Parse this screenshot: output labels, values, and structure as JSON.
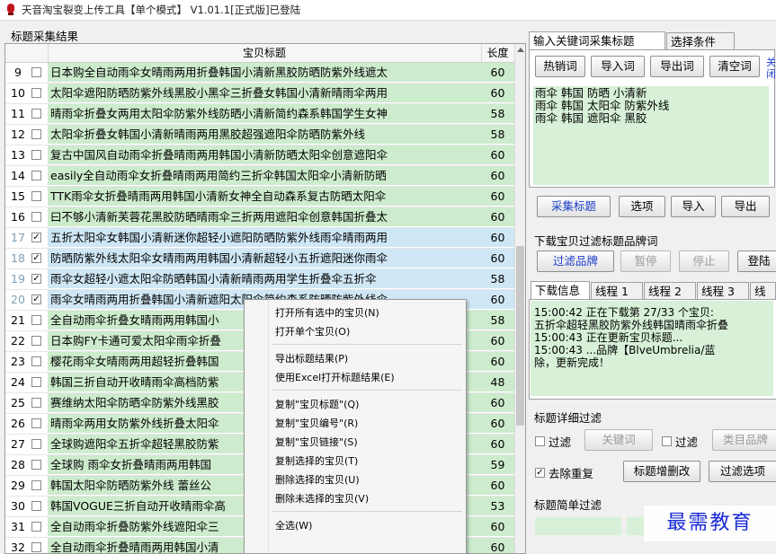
{
  "window": {
    "title": "天音淘宝裂变上传工具【单个模式】 V1.01.1[正式版]已登陆"
  },
  "left": {
    "section_label": "标题采集结果",
    "columns": {
      "title": "宝贝标题",
      "length": "长度"
    },
    "rows": [
      {
        "n": "9",
        "checked": false,
        "selected": false,
        "title": "日本购全自动雨伞女晴雨两用折叠韩国小清新黑胶防晒防紫外线遮太",
        "len": "60"
      },
      {
        "n": "10",
        "checked": false,
        "selected": false,
        "title": "太阳伞遮阳防晒防紫外线黑胶小黑伞三折叠女韩国小清新晴雨伞两用",
        "len": "60"
      },
      {
        "n": "11",
        "checked": false,
        "selected": false,
        "title": "晴雨伞折叠女两用太阳伞防紫外线防晒小清新简约森系韩国学生女神",
        "len": "58"
      },
      {
        "n": "12",
        "checked": false,
        "selected": false,
        "title": "太阳伞折叠女韩国小清新晴雨两用黑胶超强遮阳伞防晒防紫外线",
        "len": "58"
      },
      {
        "n": "13",
        "checked": false,
        "selected": false,
        "title": "复古中国风自动雨伞折叠晴雨两用韩国小清新防晒太阳伞创意遮阳伞",
        "len": "60"
      },
      {
        "n": "14",
        "checked": false,
        "selected": false,
        "title": "easily全自动雨伞女折叠晴雨两用简约三折伞韩国太阳伞小清新防晒",
        "len": "60"
      },
      {
        "n": "15",
        "checked": false,
        "selected": false,
        "title": "TTK雨伞女折叠晴雨两用韩国小清新女神全自动森系复古防晒太阳伞",
        "len": "60"
      },
      {
        "n": "16",
        "checked": false,
        "selected": false,
        "title": "曰不够小清新芙蓉花黑胶防晒晴雨伞三折两用遮阳伞创意韩国折叠太",
        "len": "60"
      },
      {
        "n": "17",
        "checked": true,
        "selected": true,
        "title": "五折太阳伞女韩国小清新迷你超轻小遮阳防晒防紫外线雨伞晴雨两用",
        "len": "60"
      },
      {
        "n": "18",
        "checked": true,
        "selected": true,
        "title": "防晒防紫外线太阳伞女晴雨两用韩国小清新超轻小五折遮阳迷你雨伞",
        "len": "60"
      },
      {
        "n": "19",
        "checked": true,
        "selected": true,
        "title": "雨伞女超轻小遮太阳伞防晒韩国小清新晴雨两用学生折叠伞五折伞",
        "len": "58"
      },
      {
        "n": "20",
        "checked": true,
        "selected": true,
        "title": "雨伞女晴雨两用折叠韩国小清新遮阳太阳伞简约森系防晒防紫外线伞",
        "len": "60"
      },
      {
        "n": "21",
        "checked": false,
        "selected": false,
        "title": "全自动雨伞折叠女晴雨两用韩国小",
        "len": "58"
      },
      {
        "n": "22",
        "checked": false,
        "selected": false,
        "title": "日本购FY卡通可爱太阳伞雨伞折叠",
        "len": "60"
      },
      {
        "n": "23",
        "checked": false,
        "selected": false,
        "title": "樱花雨伞女晴雨两用超轻折叠韩国",
        "len": "60"
      },
      {
        "n": "24",
        "checked": false,
        "selected": false,
        "title": "韩国三折自动开收晴雨伞高档防紫",
        "len": "48"
      },
      {
        "n": "25",
        "checked": false,
        "selected": false,
        "title": "赛维纳太阳伞防晒伞防紫外线黑胶",
        "len": "60"
      },
      {
        "n": "26",
        "checked": false,
        "selected": false,
        "title": "晴雨伞两用女防紫外线折叠太阳伞",
        "len": "60"
      },
      {
        "n": "27",
        "checked": false,
        "selected": false,
        "title": "全球购遮阳伞五折伞超轻黑胶防紫",
        "len": "60"
      },
      {
        "n": "28",
        "checked": false,
        "selected": false,
        "title": "全球购 雨伞女折叠晴雨两用韩国",
        "len": "59"
      },
      {
        "n": "29",
        "checked": false,
        "selected": false,
        "title": "韩国太阳伞防晒防紫外线 蕾丝公",
        "len": "60"
      },
      {
        "n": "30",
        "checked": false,
        "selected": false,
        "title": "韩国VOGUE三折自动开收晴雨伞高",
        "len": "53"
      },
      {
        "n": "31",
        "checked": false,
        "selected": false,
        "title": "全自动雨伞折叠防紫外线遮阳伞三",
        "len": "60"
      },
      {
        "n": "32",
        "checked": false,
        "selected": false,
        "title": "全自动雨伞折叠晴雨两用韩国小清",
        "len": "60"
      }
    ]
  },
  "context_menu": {
    "groups": [
      [
        "打开所有选中的宝贝(N)",
        "打开单个宝贝(O)"
      ],
      [
        "导出标题结果(P)",
        "使用Excel打开标题结果(E)"
      ],
      [
        "复制\"宝贝标题\"(Q)",
        "复制\"宝贝编号\"(R)",
        "复制\"宝贝链接\"(S)",
        "复制选择的宝贝(T)",
        "删除选择的宝贝(U)",
        "删除未选择的宝贝(V)"
      ],
      [
        "全选(W)"
      ]
    ]
  },
  "right": {
    "tabs": [
      "输入关键词采集标题",
      "选择条件"
    ],
    "kw_buttons": [
      "热销词",
      "导入词",
      "导出词",
      "清空词"
    ],
    "link_fragment": "关\n闭",
    "keywords": "雨伞 韩国 防晒 小清新\n雨伞 韩国 太阳伞 防紫外线\n雨伞 韩国 遮阳伞 黑胶",
    "action_buttons": [
      "采集标题",
      "选项",
      "导入",
      "导出"
    ],
    "brand_label": "下载宝贝过滤标题品牌词",
    "brand_buttons": [
      "过滤品牌",
      "暂停",
      "停止",
      "登陆"
    ],
    "log_tabs": [
      "下载信息",
      "线程 1",
      "线程 2",
      "线程 3",
      "线"
    ],
    "log_lines": [
      "15:00:42 正在下载第 27/33 个宝贝:",
      "五折伞超轻黑胶防紫外线韩国晴雨伞折叠",
      "15:00:43 正在更新宝贝标题...",
      "15:00:43 ...品牌【BlveUmbrelia/蓝",
      "除，更新完成！"
    ],
    "detail_filter_label": "标题详细过滤",
    "filter_check_label": "过滤",
    "keyword_button": "关键词",
    "category_button": "类目品牌",
    "dedupe_label": "去除重复",
    "dedupe_checked": true,
    "title_edit_button": "标题增删改",
    "filter_option_button": "过滤选项",
    "simple_filter_label": "标题简单过滤"
  },
  "watermark": "最需教育"
}
